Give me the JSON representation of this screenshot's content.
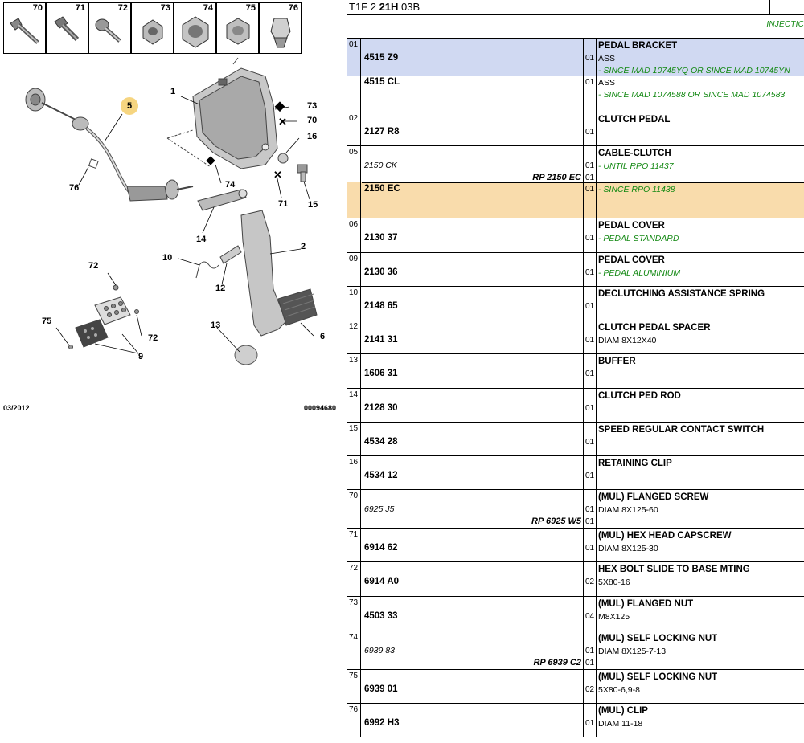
{
  "diagram": {
    "thumbnails": [
      "70",
      "71",
      "72",
      "73",
      "74",
      "75",
      "76"
    ],
    "callouts": [
      {
        "id": "5",
        "label": "5",
        "highlight": true
      },
      {
        "id": "1",
        "label": "1"
      },
      {
        "id": "73",
        "label": "73"
      },
      {
        "id": "70",
        "label": "70"
      },
      {
        "id": "16",
        "label": "16"
      },
      {
        "id": "76",
        "label": "76"
      },
      {
        "id": "74",
        "label": "74"
      },
      {
        "id": "71",
        "label": "71"
      },
      {
        "id": "15",
        "label": "15"
      },
      {
        "id": "14",
        "label": "14"
      },
      {
        "id": "2",
        "label": "2"
      },
      {
        "id": "10",
        "label": "10"
      },
      {
        "id": "12",
        "label": "12"
      },
      {
        "id": "72a",
        "label": "72"
      },
      {
        "id": "75",
        "label": "75"
      },
      {
        "id": "72b",
        "label": "72"
      },
      {
        "id": "9",
        "label": "9"
      },
      {
        "id": "13",
        "label": "13"
      },
      {
        "id": "6",
        "label": "6"
      }
    ],
    "footer_date": "03/2012",
    "footer_ref": "00094680"
  },
  "header": {
    "code_prefix": "T1F 2 ",
    "code_bold": "21H",
    "code_suffix": " 03B",
    "section": "INJECTIC"
  },
  "rows": [
    {
      "item": "01",
      "lines": [
        {
          "ref": "4515 Z9",
          "qty": "01",
          "title": "PEDAL BRACKET",
          "desc": "ASS",
          "note": "- SINCE MAD 10745YQ OR SINCE MAD 10745YN",
          "bg": "blue"
        },
        {
          "ref": "4515 CL",
          "qty": "01",
          "desc": "ASS",
          "note": "- SINCE MAD 1074588 OR SINCE MAD 1074583"
        }
      ]
    },
    {
      "item": "02",
      "lines": [
        {
          "ref": "2127 R8",
          "qty": "01",
          "title": "CLUTCH PEDAL"
        }
      ]
    },
    {
      "item": "05",
      "lines": [
        {
          "ref_alt": "2150 CK",
          "qty": "01",
          "title": "CABLE-CLUTCH",
          "note": "- UNTIL RPO 11437",
          "rp": "RP 2150 EC",
          "rp_qty": "01"
        },
        {
          "ref": "2150 EC",
          "qty": "01",
          "note": "- SINCE RPO 11438",
          "bg": "orange"
        }
      ]
    },
    {
      "item": "06",
      "lines": [
        {
          "ref": "2130 37",
          "qty": "01",
          "title": "PEDAL COVER",
          "note": "- PEDAL STANDARD"
        }
      ]
    },
    {
      "item": "09",
      "lines": [
        {
          "ref": "2130 36",
          "qty": "01",
          "title": "PEDAL COVER",
          "note": "- PEDAL ALUMINIUM"
        }
      ]
    },
    {
      "item": "10",
      "lines": [
        {
          "ref": "2148 65",
          "qty": "01",
          "title": "DECLUTCHING ASSISTANCE SPRING"
        }
      ]
    },
    {
      "item": "12",
      "lines": [
        {
          "ref": "2141 31",
          "qty": "01",
          "title": "CLUTCH PEDAL SPACER",
          "desc": "DIAM 8X12X40"
        }
      ]
    },
    {
      "item": "13",
      "lines": [
        {
          "ref": "1606 31",
          "qty": "01",
          "title": "BUFFER"
        }
      ]
    },
    {
      "item": "14",
      "lines": [
        {
          "ref": "2128 30",
          "qty": "01",
          "title": "CLUTCH PED ROD"
        }
      ]
    },
    {
      "item": "15",
      "lines": [
        {
          "ref": "4534 28",
          "qty": "01",
          "title": "SPEED REGULAR CONTACT SWITCH"
        }
      ]
    },
    {
      "item": "16",
      "lines": [
        {
          "ref": "4534 12",
          "qty": "01",
          "title": "RETAINING CLIP"
        }
      ]
    },
    {
      "item": "70",
      "lines": [
        {
          "ref_alt": "6925 J5",
          "qty": "01",
          "title": "(MUL) FLANGED SCREW",
          "desc": "DIAM 8X125-60",
          "rp": "RP 6925 W5",
          "rp_qty": "01"
        }
      ]
    },
    {
      "item": "71",
      "lines": [
        {
          "ref": "6914 62",
          "qty": "01",
          "title": "(MUL) HEX HEAD CAPSCREW",
          "desc": "DIAM 8X125-30"
        }
      ]
    },
    {
      "item": "72",
      "lines": [
        {
          "ref": "6914 A0",
          "qty": "02",
          "title": "HEX BOLT SLIDE TO BASE MTING",
          "desc": "5X80-16"
        }
      ]
    },
    {
      "item": "73",
      "lines": [
        {
          "ref": "4503 33",
          "qty": "04",
          "title": "(MUL) FLANGED NUT",
          "desc": "M8X125"
        }
      ]
    },
    {
      "item": "74",
      "lines": [
        {
          "ref_alt": "6939 83",
          "qty": "01",
          "title": "(MUL) SELF LOCKING NUT",
          "desc": "DIAM 8X125-7-13",
          "rp": "RP 6939 C2",
          "rp_qty": "01"
        }
      ]
    },
    {
      "item": "75",
      "lines": [
        {
          "ref": "6939 01",
          "qty": "02",
          "title": "(MUL) SELF LOCKING NUT",
          "desc": "5X80-6,9-8"
        }
      ]
    },
    {
      "item": "76",
      "lines": [
        {
          "ref": "6992 H3",
          "qty": "01",
          "title": "(MUL) CLIP",
          "desc": "DIAM 11-18"
        }
      ]
    }
  ],
  "colors": {
    "highlight_blue": "#d0d9f2",
    "highlight_orange": "#f9dcac",
    "note_green": "#118811",
    "callout_highlight": "#f6d580"
  }
}
